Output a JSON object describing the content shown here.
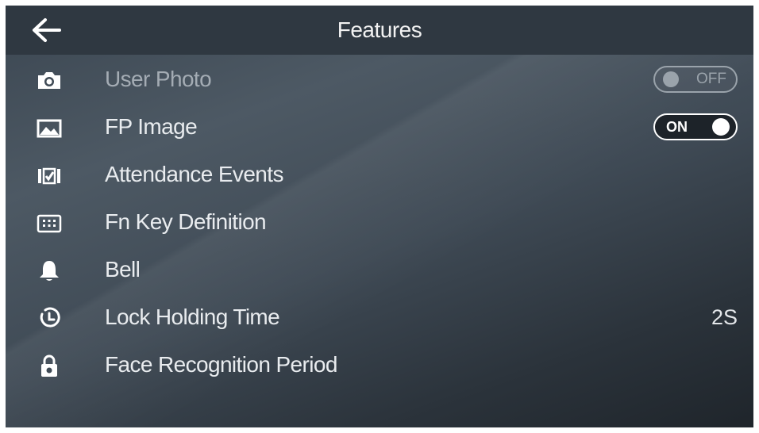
{
  "header": {
    "title": "Features",
    "back_icon": "back-arrow-icon"
  },
  "rows": [
    {
      "label": "User Photo",
      "icon": "camera-icon",
      "toggle": {
        "state": "off",
        "label": "OFF"
      }
    },
    {
      "label": "FP Image",
      "icon": "image-icon",
      "toggle": {
        "state": "on",
        "label": "ON"
      }
    },
    {
      "label": "Attendance Events",
      "icon": "checklist-icon"
    },
    {
      "label": "Fn Key Definition",
      "icon": "keypad-icon"
    },
    {
      "label": "Bell",
      "icon": "bell-icon"
    },
    {
      "label": "Lock Holding Time",
      "icon": "timer-icon",
      "value": "2S"
    },
    {
      "label": "Face Recognition Period",
      "icon": "lock-icon"
    }
  ],
  "colors": {
    "header_bg": "#2f3841",
    "text": "#e9ecef",
    "dim_text": "#a4acb4"
  }
}
